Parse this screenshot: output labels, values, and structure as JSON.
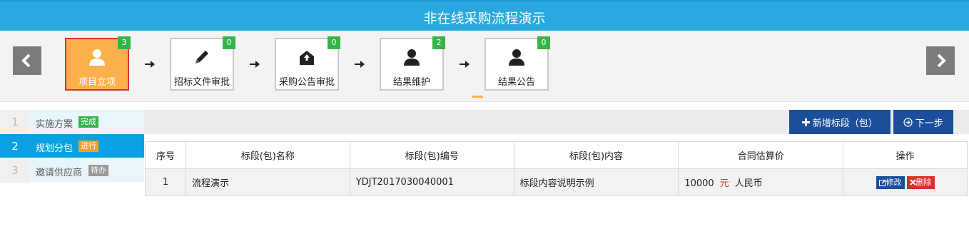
{
  "header": {
    "title": "非在线采购流程演示"
  },
  "steps": [
    {
      "label": "项目立项",
      "count": "3",
      "icon": "user-icon",
      "active": true
    },
    {
      "label": "招标文件审批",
      "count": "0",
      "icon": "pencil-icon",
      "active": false
    },
    {
      "label": "采购公告审批",
      "count": "0",
      "icon": "envelope-upload-icon",
      "active": false
    },
    {
      "label": "结果维护",
      "count": "2",
      "icon": "user-icon",
      "active": false
    },
    {
      "label": "结果公告",
      "count": "0",
      "icon": "user-icon",
      "active": false
    }
  ],
  "sidebar": {
    "items": [
      {
        "num": "1",
        "name": "实施方案",
        "tag": "完成"
      },
      {
        "num": "2",
        "name": "规划分包",
        "tag": "进行"
      },
      {
        "num": "3",
        "name": "邀请供应商",
        "tag": "待办"
      }
    ]
  },
  "toolbar": {
    "add_label": "新增标段（包）",
    "next_label": "下一步"
  },
  "table": {
    "headers": [
      "序号",
      "标段(包)名称",
      "标段(包)编号",
      "标段(包)内容",
      "合同估算价",
      "操作"
    ],
    "rows": [
      {
        "index": "1",
        "name": "流程演示",
        "code": "YDJT2017030040001",
        "content": "标段内容说明示例",
        "amount": "10000",
        "unit": "元",
        "currency": "人民币",
        "edit_label": "修改",
        "delete_label": "删除"
      }
    ]
  },
  "colors": {
    "header": "#29a8e0",
    "active_step": "#fbb04c",
    "badge": "#35b44a",
    "button": "#1b4f9b",
    "danger": "#d9302a"
  }
}
